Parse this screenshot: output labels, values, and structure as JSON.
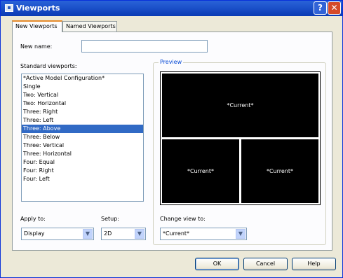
{
  "window": {
    "title": "Viewports"
  },
  "tabs": [
    {
      "label": "New Viewports"
    },
    {
      "label": "Named Viewports"
    }
  ],
  "new_name": {
    "label": "New name:",
    "value": ""
  },
  "standard_viewports": {
    "label": "Standard viewports:",
    "items": [
      "*Active Model Configuration*",
      "Single",
      "Two: Vertical",
      "Two: Horizontal",
      "Three: Right",
      "Three: Left",
      "Three: Above",
      "Three: Below",
      "Three: Vertical",
      "Three: Horizontal",
      "Four: Equal",
      "Four: Right",
      "Four: Left"
    ],
    "selected": "Three: Above"
  },
  "preview": {
    "label": "Preview",
    "viewports": [
      "*Current*",
      "*Current*",
      "*Current*"
    ]
  },
  "apply_to": {
    "label": "Apply to:",
    "value": "Display"
  },
  "setup": {
    "label": "Setup:",
    "value": "2D"
  },
  "change_view": {
    "label": "Change view to:",
    "value": "*Current*"
  },
  "buttons": {
    "ok": "OK",
    "cancel": "Cancel",
    "help": "Help"
  },
  "titlebar_buttons": {
    "help": "?",
    "close": "✕"
  },
  "colors": {
    "titlebar": "#1a4fc8",
    "selection": "#316ac5",
    "dialog_bg": "#ece9d8"
  }
}
